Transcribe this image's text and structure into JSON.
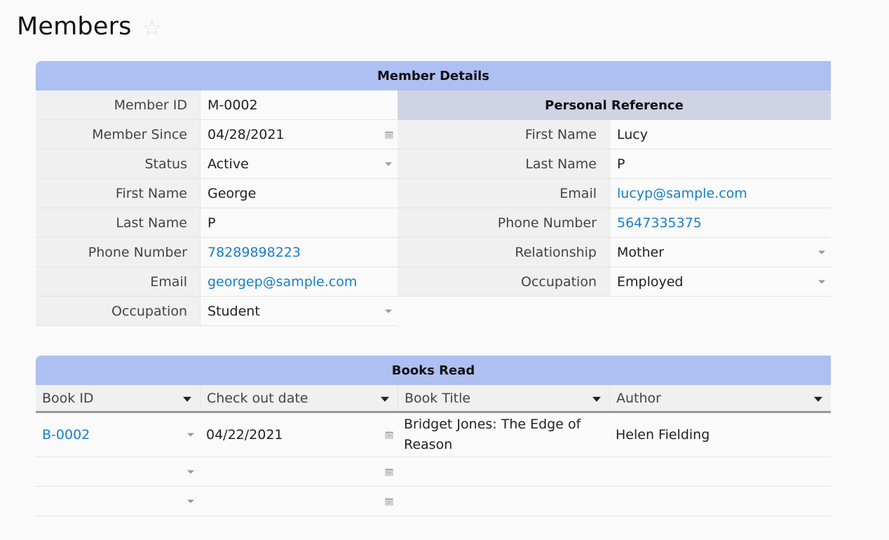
{
  "page": {
    "title": "Members"
  },
  "member_details": {
    "header": "Member Details",
    "fields": [
      {
        "label": "Member ID",
        "value": "M-0002"
      },
      {
        "label": "Member Since",
        "value": "04/28/2021"
      },
      {
        "label": "Status",
        "value": "Active"
      },
      {
        "label": "First Name",
        "value": "George"
      },
      {
        "label": "Last Name",
        "value": "P"
      },
      {
        "label": "Phone Number",
        "value": "78289898223"
      },
      {
        "label": "Email",
        "value": "georgep@sample.com"
      },
      {
        "label": "Occupation",
        "value": "Student"
      }
    ]
  },
  "personal_reference": {
    "header": "Personal Reference",
    "fields": [
      {
        "label": "First Name",
        "value": "Lucy"
      },
      {
        "label": "Last Name",
        "value": "P"
      },
      {
        "label": "Email",
        "value": "lucyp@sample.com"
      },
      {
        "label": "Phone Number",
        "value": "5647335375"
      },
      {
        "label": "Relationship",
        "value": "Mother"
      },
      {
        "label": "Occupation",
        "value": "Employed"
      }
    ]
  },
  "books_read": {
    "header": "Books Read",
    "columns": [
      "Book ID",
      "Check out date",
      "Book Title",
      "Author"
    ],
    "rows": [
      {
        "book_id": "B-0002",
        "checkout": "04/22/2021",
        "title": "Bridget Jones: The Edge of Reason",
        "author": "Helen Fielding"
      },
      {
        "book_id": "",
        "checkout": "",
        "title": "",
        "author": ""
      },
      {
        "book_id": "",
        "checkout": "",
        "title": "",
        "author": ""
      }
    ]
  },
  "colors": {
    "section_header": "#aebff2",
    "subheader": "#cfd3e3",
    "link": "#1a7fc4"
  }
}
